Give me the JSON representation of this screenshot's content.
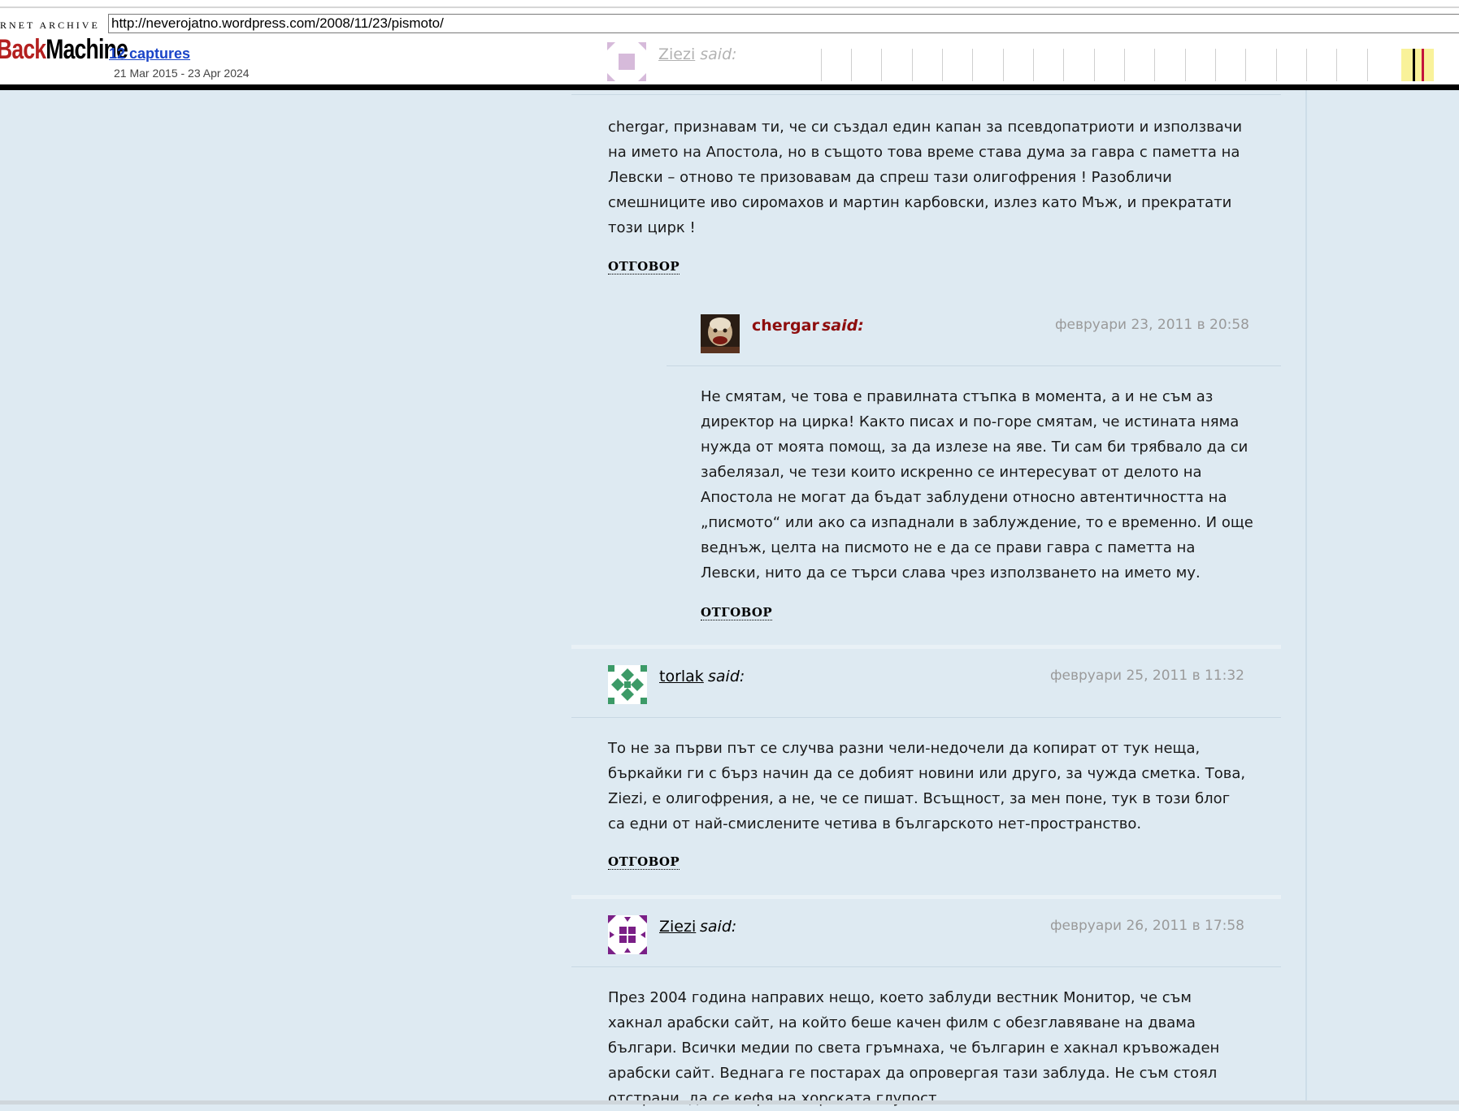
{
  "wayback": {
    "logo_small": "RNET ARCHIVE",
    "logo_back": "Back",
    "logo_machine": "Machine",
    "url": "http://neverojatno.wordpress.com/2008/11/23/pismoto/",
    "captures": "12 captures",
    "range": "21 Mar 2015 - 23 Apr 2024"
  },
  "faded_header": {
    "author": "Ziezi",
    "said": "said:"
  },
  "comments": [
    {
      "text": "chergar, признавам ти, че си създал един капан за псевдопатриоти и използвачи на името на Апостола, но в същото това време става дума за гавра с паметта на Левски – отново те призовавам да спреш тази олигофрения ! Разобличи смешниците иво сиромахов и мартин карбовски, излез като Мъж, и прекратати този цирк !",
      "reply": "ОТГОВОР"
    },
    {
      "author": "chergar",
      "said": "said:",
      "date": "февруари 23, 2011 в 20:58",
      "text": "Не смятам, че това е правилната стъпка в момента, а и не съм аз директор на цирка! Както писах и по-горе смятам, че истината няма нужда от моята помощ, за да излезе на яве. Ти сам би трябвало да си забелязал, че тези които искренно се интересуват от делото на Апостола не могат да бъдат заблудени относно автентичността на „писмото“ или ако са изпаднали в заблуждение, то е временно. И още веднъж, целта на писмото не е да се прави гавра с паметта на Левски, нито да се търси слава чрез използването на името му.",
      "reply": "ОТГОВОР"
    },
    {
      "author": "torlak",
      "said": "said:",
      "date": "февруари 25, 2011 в 11:32",
      "text": "То не за първи път се случва разни чели-недочели да копират от тук неща, бъркайки ги с бърз начин да се добият новини или друго, за чужда сметка. Това, Ziezi, е олигофрения, а не, че се пишат. Всъщност, за мен поне, тук в този блог са едни от най-смислените четива в българското нет-пространство.",
      "reply": "ОТГОВОР"
    },
    {
      "author": "Ziezi",
      "said": "said:",
      "date": "февруари 26, 2011 в 17:58",
      "text": "През 2004 година направих нещо, което заблуди вестник Монитор, че съм хакнал арабски сайт, на който беше качен филм с обезглавяване на двама българи. Всички медии по света гръмнаха, че българин е хакнал кръвожаден арабски сайт. Веднага ге постарах да опровергая тази заблуда. Не съм стоял отстрани, да се кефя на хорската глупост."
    }
  ],
  "colors": {
    "page_bg": "#deeaf2",
    "owner_name": "#8e0e0e",
    "date": "#9a9a9a",
    "wayback_back": "#b4201f"
  },
  "icons": {
    "avatar_ziezi": "identicon-purple",
    "avatar_torlak": "identicon-green",
    "avatar_chergar": "photo-avatar"
  }
}
